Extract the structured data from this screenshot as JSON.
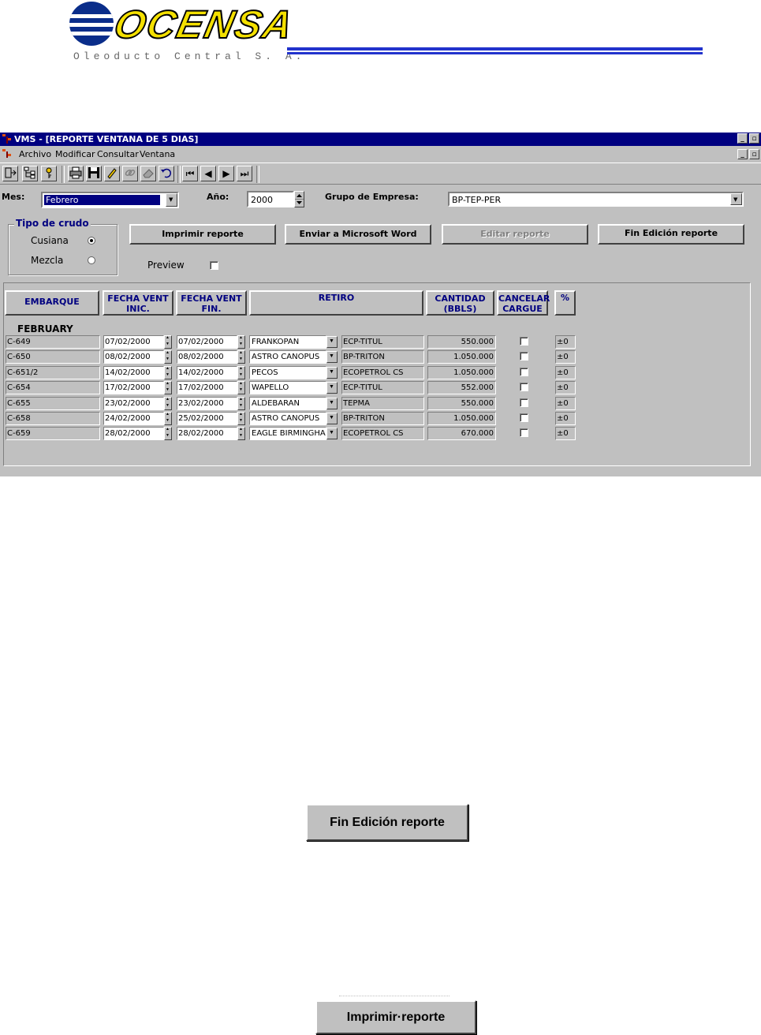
{
  "logo": {
    "brand": "OCENSA",
    "subtitle": "Oleoducto Central S. A."
  },
  "window": {
    "title": "VMS - [REPORTE VENTANA DE 5 DIAS]",
    "min_glyph": "_",
    "restore_glyph": "▫"
  },
  "menu": {
    "items": [
      "Archivo",
      "Modificar",
      "Consultar",
      "Ventana"
    ]
  },
  "toolbar": {
    "icons": [
      "exit-icon",
      "tree-icon",
      "key-icon",
      "print-icon",
      "save-icon",
      "edit-icon",
      "link-icon",
      "eraser-icon",
      "undo-icon",
      "first-record-icon",
      "previous-record-icon",
      "next-record-icon",
      "last-record-icon"
    ],
    "glyphs": {
      "first": "⏮",
      "prev": "◀",
      "next": "▶",
      "last": "⏭"
    }
  },
  "filters": {
    "mes_label": "Mes:",
    "mes_value": "Febrero",
    "anio_label": "Año:",
    "anio_value": "2000",
    "grupo_label": "Grupo de Empresa:",
    "grupo_value": "BP-TEP-PER"
  },
  "tipo_crudo": {
    "legend": "Tipo de crudo",
    "options": [
      {
        "label": "Cusiana",
        "selected": true
      },
      {
        "label": "Mezcla",
        "selected": false
      }
    ]
  },
  "actions": {
    "imprimir": "Imprimir reporte",
    "enviar_word": "Enviar  a Microsoft Word",
    "editar": "Editar reporte",
    "fin_edicion": "Fin Edición reporte",
    "preview_label": "Preview"
  },
  "table": {
    "headers": {
      "embarque": "EMBARQUE",
      "fecha_ini": "FECHA VENT\nINIC.",
      "fecha_fin": "FECHA VENT\nFIN.",
      "retiro": "RETIRO",
      "cantidad": "CANTIDAD\n(BBLS)",
      "cancelar": "CANCELAR\nCARGUE",
      "pct": "%"
    },
    "group_label": "FEBRUARY",
    "rows": [
      {
        "embarque": "C-649",
        "fecha_ini": "07/02/2000",
        "fecha_fin": "07/02/2000",
        "buque": "FRANKOPAN",
        "empresa": "ECP-TITUL",
        "cantidad": "550.000",
        "pct": "±0"
      },
      {
        "embarque": "C-650",
        "fecha_ini": "08/02/2000",
        "fecha_fin": "08/02/2000",
        "buque": "ASTRO CANOPUS",
        "empresa": "BP-TRITON",
        "cantidad": "1.050.000",
        "pct": "±0"
      },
      {
        "embarque": "C-651/2",
        "fecha_ini": "14/02/2000",
        "fecha_fin": "14/02/2000",
        "buque": "PECOS",
        "empresa": "ECOPETROL CS",
        "cantidad": "1.050.000",
        "pct": "±0"
      },
      {
        "embarque": "C-654",
        "fecha_ini": "17/02/2000",
        "fecha_fin": "17/02/2000",
        "buque": "WAPELLO",
        "empresa": "ECP-TITUL",
        "cantidad": "552.000",
        "pct": "±0"
      },
      {
        "embarque": "C-655",
        "fecha_ini": "23/02/2000",
        "fecha_fin": "23/02/2000",
        "buque": "ALDEBARAN",
        "empresa": "TEPMA",
        "cantidad": "550.000",
        "pct": "±0"
      },
      {
        "embarque": "C-658",
        "fecha_ini": "24/02/2000",
        "fecha_fin": "25/02/2000",
        "buque": "ASTRO CANOPUS",
        "empresa": "BP-TRITON",
        "cantidad": "1.050.000",
        "pct": "±0"
      },
      {
        "embarque": "C-659",
        "fecha_ini": "28/02/2000",
        "fecha_fin": "28/02/2000",
        "buque": "EAGLE BIRMINGHAM",
        "empresa": "ECOPETROL CS",
        "cantidad": "670.000",
        "pct": "±0"
      }
    ]
  },
  "detail_buttons": {
    "fin_edicion": "Fin Edición reporte",
    "imprimir": "Imprimir·reporte"
  }
}
